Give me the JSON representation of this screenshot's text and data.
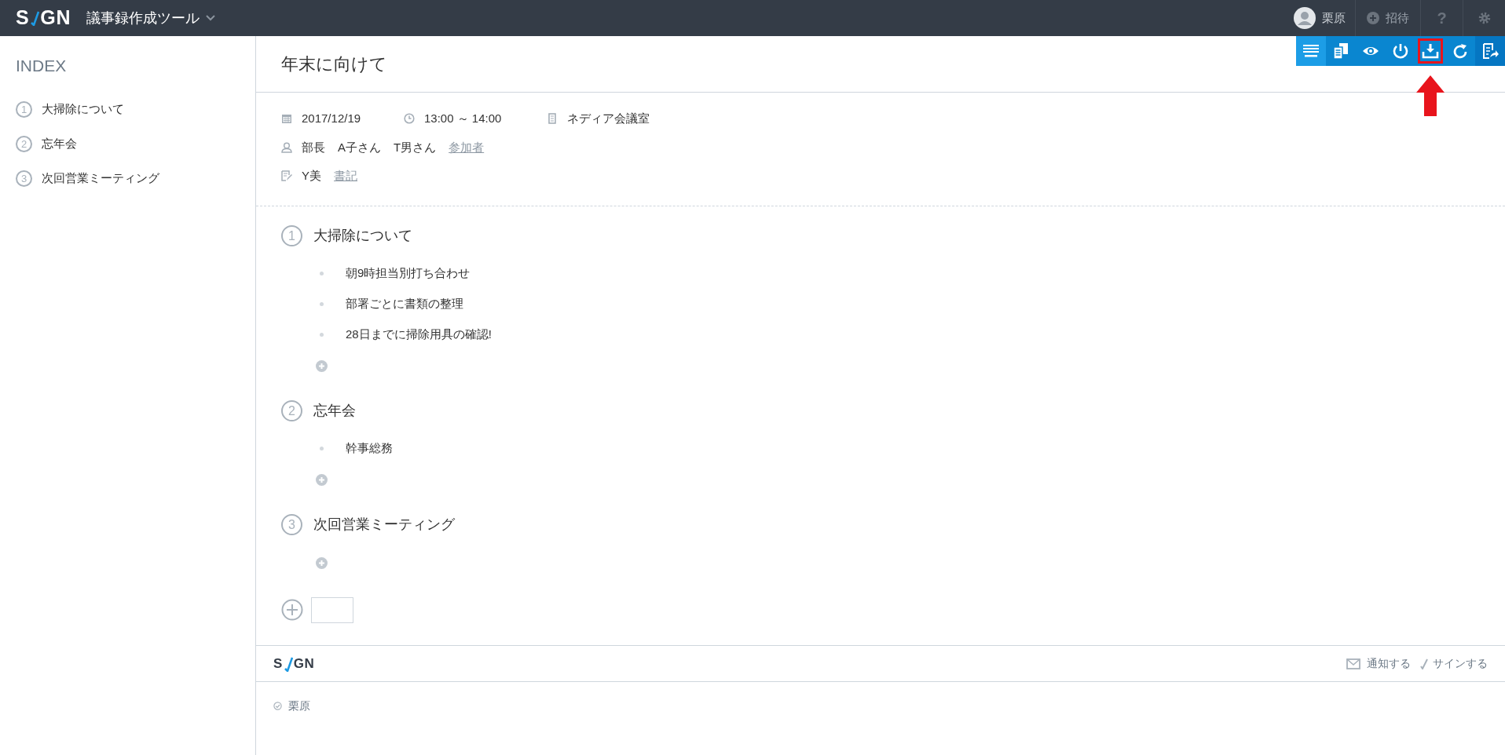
{
  "header": {
    "logo": [
      "S",
      "GN"
    ],
    "app_title": "議事録作成ツール",
    "user": "栗原",
    "invite": "招待",
    "help": "?"
  },
  "sidebar": {
    "title": "INDEX",
    "items": [
      {
        "number": "1",
        "label": "大掃除について"
      },
      {
        "number": "2",
        "label": "忘年会"
      },
      {
        "number": "3",
        "label": "次回営業ミーティング"
      }
    ]
  },
  "toolbar": [
    {
      "kind": "keyboard",
      "highlighted": false
    },
    {
      "kind": "copy",
      "highlighted": false
    },
    {
      "kind": "eye",
      "highlighted": false
    },
    {
      "kind": "power",
      "highlighted": false
    },
    {
      "kind": "download",
      "highlighted": true
    },
    {
      "kind": "refresh",
      "highlighted": false
    },
    {
      "kind": "export",
      "highlighted": false
    }
  ],
  "title": "年末に向けて",
  "meta": {
    "date": "2017/12/19",
    "time": "13:00 ～ 14:00",
    "room": "ネディア会議室",
    "attendees": [
      "部長",
      "A子さん",
      "T男さん"
    ],
    "attendees_link": "参加者",
    "writer": "Y美",
    "writer_link": "書記"
  },
  "agenda": [
    {
      "number": "1",
      "title": "大掃除について",
      "points": [
        "朝9時担当別打ち合わせ",
        "部署ごとに書類の整理",
        "28日までに掃除用具の確認!"
      ]
    },
    {
      "number": "2",
      "title": "忘年会",
      "points": [
        "幹事総務"
      ]
    },
    {
      "number": "3",
      "title": "次回営業ミーティング"
    }
  ],
  "footer": {
    "logo": [
      "S",
      "GN"
    ],
    "notify": "通知する",
    "sign": "サインする",
    "signers": [
      "栗原"
    ]
  }
}
